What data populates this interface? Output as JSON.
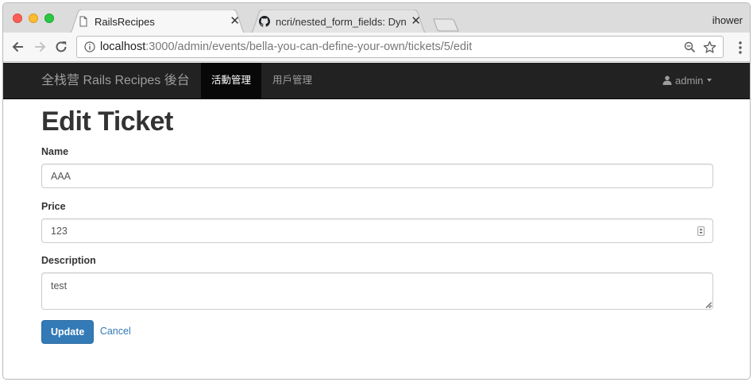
{
  "browser": {
    "tabs": [
      {
        "title": "RailsRecipes",
        "active": true,
        "close": "✕"
      },
      {
        "title": "ncri/nested_form_fields: Dynam",
        "active": false,
        "close": "✕"
      }
    ],
    "profile": "ihower",
    "url": {
      "host": "localhost",
      "rest": ":3000/admin/events/bella-you-can-define-your-own/tickets/5/edit"
    },
    "icons": [
      "back-icon",
      "forward-icon",
      "reload-icon",
      "info-icon",
      "zoom-icon",
      "star-icon",
      "menu-icon",
      "page-icon",
      "github-icon"
    ]
  },
  "navbar": {
    "brand": "全栈营 Rails Recipes 後台",
    "items": [
      {
        "label": "活動管理",
        "active": true
      },
      {
        "label": "用戶管理",
        "active": false
      }
    ],
    "user": "admin"
  },
  "page": {
    "title": "Edit Ticket",
    "fields": {
      "name": {
        "label": "Name",
        "value": "AAA"
      },
      "price": {
        "label": "Price",
        "value": "123"
      },
      "description": {
        "label": "Description",
        "value": "test"
      }
    },
    "submit": "Update",
    "cancel": "Cancel"
  },
  "colors": {
    "navbar_bg": "#222222",
    "primary": "#337ab7",
    "link": "#337ab7"
  }
}
